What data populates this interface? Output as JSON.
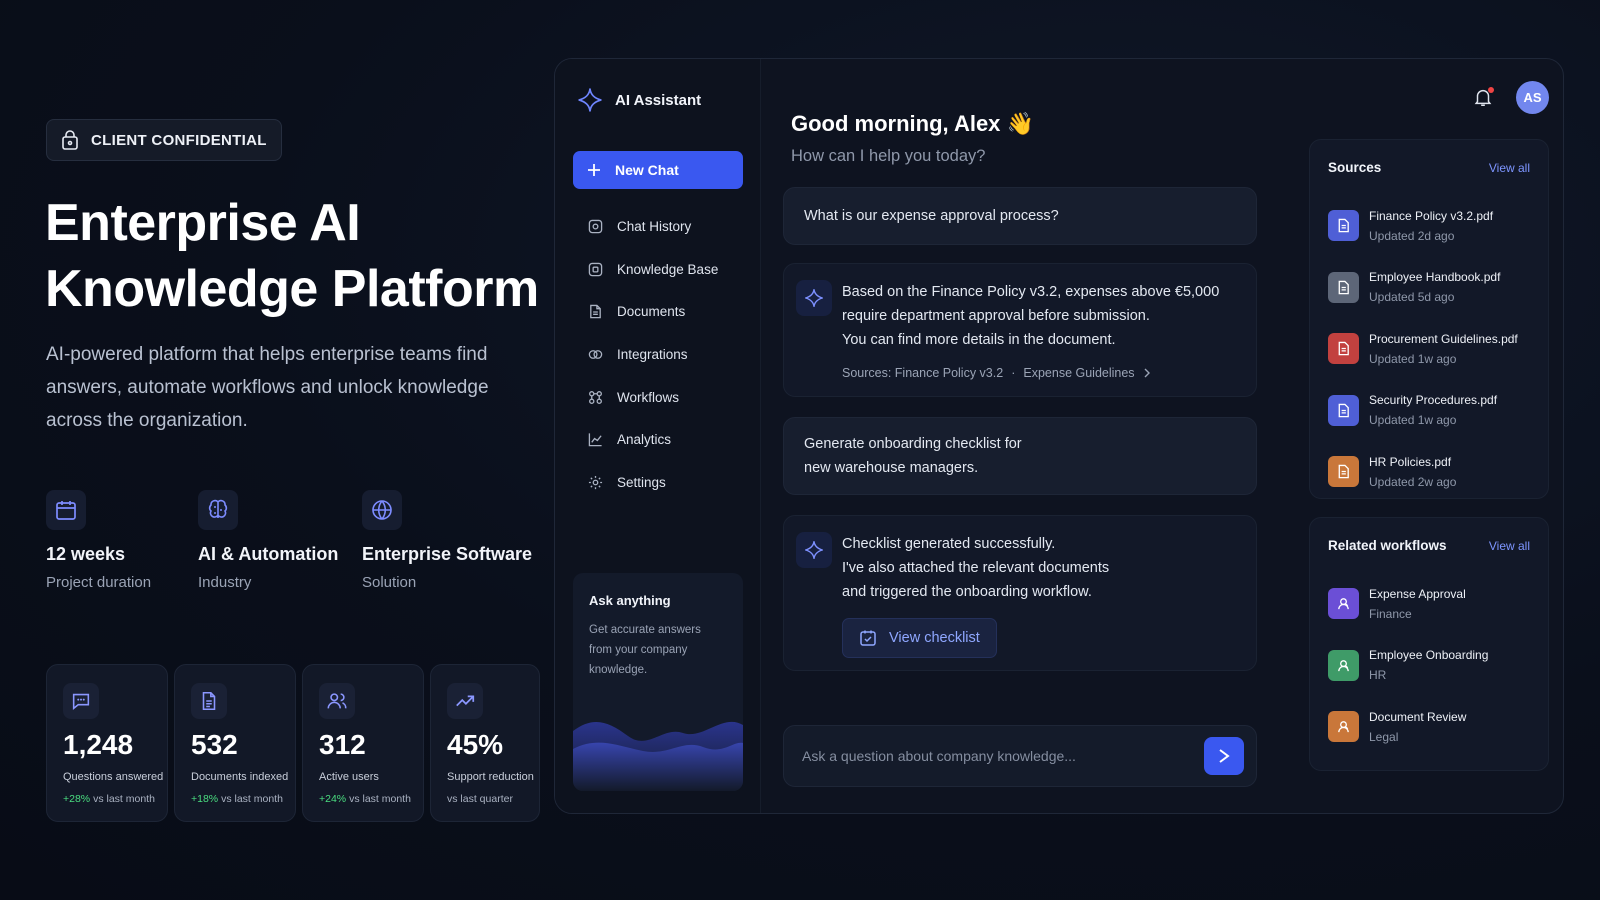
{
  "badge": {
    "label": "CLIENT CONFIDENTIAL"
  },
  "hero": {
    "title_line1": "Enterprise AI",
    "title_line2": "Knowledge Platform",
    "description": "AI-powered platform that helps enterprise teams find answers, automate workflows and unlock knowledge across the organization."
  },
  "facts": [
    {
      "icon": "calendar-icon",
      "value": "12 weeks",
      "label": "Project duration"
    },
    {
      "icon": "brain-icon",
      "value": "AI & Automation",
      "label": "Industry"
    },
    {
      "icon": "globe-icon",
      "value": "Enterprise Software",
      "label": "Solution"
    }
  ],
  "stats": [
    {
      "icon": "chat-icon",
      "value": "1,248",
      "label": "Questions answered",
      "delta": "+28%",
      "delta_suffix": "vs last month"
    },
    {
      "icon": "document-icon",
      "value": "532",
      "label": "Documents indexed",
      "delta": "+18%",
      "delta_suffix": "vs last month"
    },
    {
      "icon": "users-icon",
      "value": "312",
      "label": "Active users",
      "delta": "+24%",
      "delta_suffix": "vs last month"
    },
    {
      "icon": "trend-up-icon",
      "value": "45%",
      "label": "Support reduction",
      "delta": "",
      "delta_suffix": "vs last quarter"
    }
  ],
  "app": {
    "brand": "AI Assistant",
    "new_chat": "New Chat",
    "nav": [
      "Chat History",
      "Knowledge Base",
      "Documents",
      "Integrations",
      "Workflows",
      "Analytics",
      "Settings"
    ],
    "ask_card": {
      "title": "Ask anything",
      "text": "Get accurate answers from your company knowledge."
    },
    "greeting": "Good morning, Alex 👋",
    "subgreeting": "How can I help you today?",
    "messages": {
      "q1": "What is our expense approval process?",
      "a1_line1": "Based on the Finance Policy v3.2, expenses above €5,000",
      "a1_line2": "require department approval before submission.",
      "a1_line3": "You can find more details in the document.",
      "a1_sources_label": "Sources: Finance Policy v3.2",
      "a1_sources_sep": "·",
      "a1_sources_extra": "Expense Guidelines",
      "q2_line1": "Generate onboarding checklist for",
      "q2_line2": "new warehouse managers.",
      "a2_line1": "Checklist generated successfully.",
      "a2_line2": "I've also attached the relevant documents",
      "a2_line3": "and triggered the onboarding workflow.",
      "a2_button": "View checklist"
    },
    "composer_placeholder": "Ask a question about company knowledge...",
    "avatar_initials": "AS",
    "sources": {
      "title": "Sources",
      "view_all": "View all",
      "items": [
        {
          "name": "Finance Policy v3.2.pdf",
          "updated": "Updated 2d ago",
          "color": "#4f5fd6"
        },
        {
          "name": "Employee Handbook.pdf",
          "updated": "Updated 5d ago",
          "color": "#5d6678"
        },
        {
          "name": "Procurement Guidelines.pdf",
          "updated": "Updated 1w ago",
          "color": "#c2413f"
        },
        {
          "name": "Security Procedures.pdf",
          "updated": "Updated 1w ago",
          "color": "#4f5fd6"
        },
        {
          "name": "HR Policies.pdf",
          "updated": "Updated 2w ago",
          "color": "#c9773a"
        }
      ]
    },
    "workflows": {
      "title": "Related workflows",
      "view_all": "View all",
      "items": [
        {
          "name": "Expense Approval",
          "dept": "Finance",
          "color": "#6b4fd6"
        },
        {
          "name": "Employee Onboarding",
          "dept": "HR",
          "color": "#3f9b68"
        },
        {
          "name": "Document Review",
          "dept": "Legal",
          "color": "#c9773a"
        }
      ]
    }
  },
  "colors": {
    "accent": "#3a58f0",
    "positive": "#4ade80",
    "link": "#7d95ff"
  }
}
